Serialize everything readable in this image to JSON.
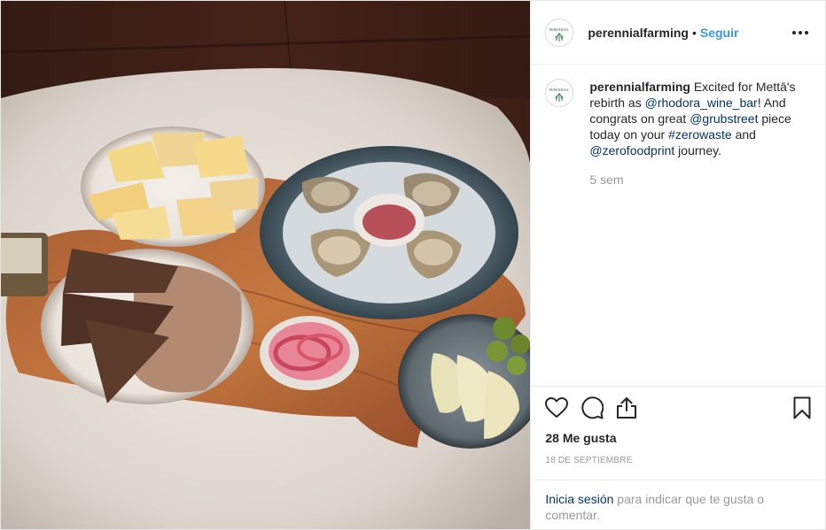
{
  "post": {
    "username": "perennialfarming",
    "follow_label": "Seguir",
    "separator": "•",
    "caption": {
      "part1": " Excited for Mettā's rebirth as ",
      "mention1": "@rhodora_wine_bar",
      "part2": "! And congrats on great ",
      "mention2": "@grubstreet",
      "part3": " piece today on your ",
      "hashtag": "#zerowaste",
      "part4": " and ",
      "mention3": "@zerofoodprint",
      "part5": " journey."
    },
    "time_ago": "5 sem",
    "likes": "28 Me gusta",
    "date": "18 DE SEPTIEMBRE",
    "login_link": "Inicia sesión",
    "login_text": " para indicar que te gusta o comentar."
  },
  "icons": {
    "more": "more-options-icon",
    "like": "heart-icon",
    "comment": "comment-icon",
    "share": "share-icon",
    "save": "bookmark-icon"
  },
  "colors": {
    "follow": "#3897f0",
    "link": "#003569",
    "muted": "#999999",
    "text": "#262626"
  }
}
